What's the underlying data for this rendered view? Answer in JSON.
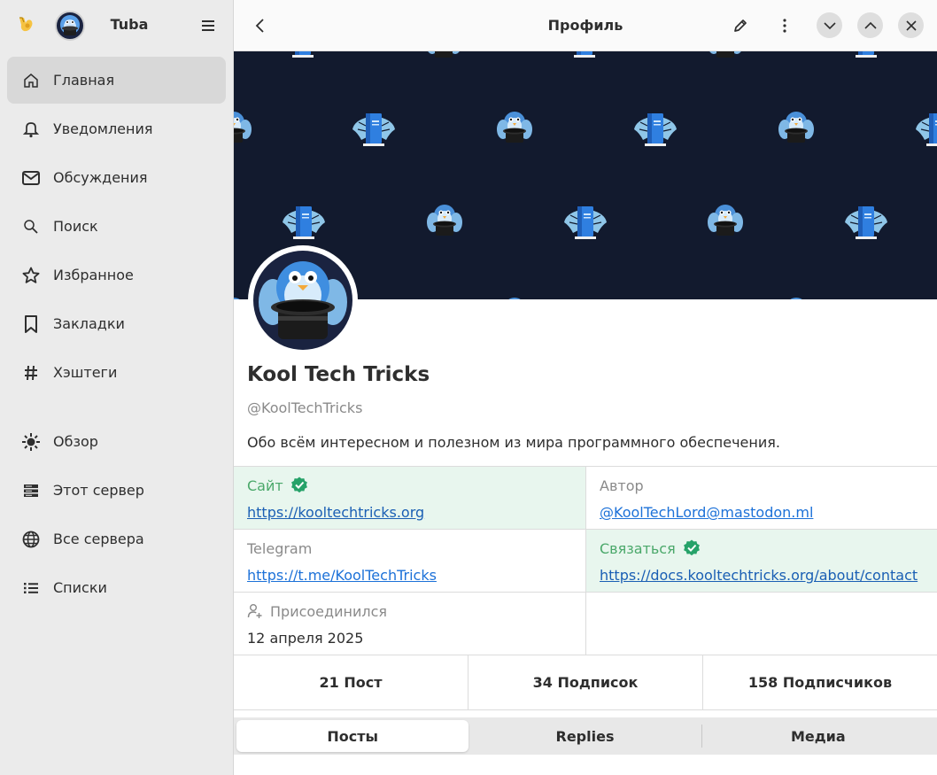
{
  "app": {
    "title": "Tuba"
  },
  "sidebar": {
    "items": [
      {
        "label": "Главная",
        "icon": "home-icon",
        "active": true
      },
      {
        "label": "Уведомления",
        "icon": "bell-icon"
      },
      {
        "label": "Обсуждения",
        "icon": "mail-icon"
      },
      {
        "label": "Поиск",
        "icon": "search-icon"
      },
      {
        "label": "Избранное",
        "icon": "star-icon"
      },
      {
        "label": "Закладки",
        "icon": "bookmark-icon"
      },
      {
        "label": "Хэштеги",
        "icon": "hashtag-icon"
      }
    ],
    "items2": [
      {
        "label": "Обзор",
        "icon": "explore-icon"
      },
      {
        "label": "Этот сервер",
        "icon": "server-icon"
      },
      {
        "label": "Все сервера",
        "icon": "globe-icon"
      },
      {
        "label": "Списки",
        "icon": "list-icon"
      }
    ]
  },
  "topbar": {
    "title": "Профиль"
  },
  "profile": {
    "name": "Kool Tech Tricks",
    "handle": "@KoolTechTricks",
    "bio": "Обо всём интересном и полезном из мира программного обеспечения.",
    "fields": [
      {
        "name": "Сайт",
        "value": "https://kooltechtricks.org",
        "verified": true,
        "link": true
      },
      {
        "name": "Автор",
        "value": "@KoolTechLord@mastodon.ml",
        "verified": false,
        "link": true
      },
      {
        "name": "Telegram",
        "value": "https://t.me/KoolTechTricks",
        "verified": false,
        "link": true
      },
      {
        "name": "Связаться",
        "value": "https://docs.kooltechtricks.org/about/contact",
        "verified": true,
        "link": true
      },
      {
        "name": "Присоединился",
        "value": "12 апреля 2025",
        "verified": false,
        "link": false
      }
    ],
    "stats": {
      "posts": "21 Пост",
      "following": "34 Подписок",
      "followers": "158 Подписчиков"
    },
    "tabs": [
      "Посты",
      "Replies",
      "Медиа"
    ]
  },
  "colors": {
    "accent": "#1c71d8",
    "verified_bg": "#e8f6ee",
    "verified_check": "#26a269",
    "banner_bg": "#121a2e"
  }
}
